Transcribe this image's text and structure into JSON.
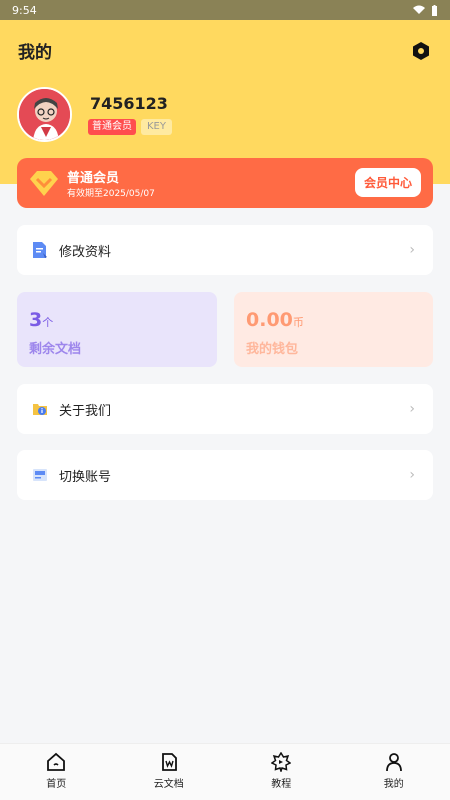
{
  "status_bar": {
    "time": "9:54"
  },
  "header": {
    "title": "我的"
  },
  "profile": {
    "username": "7456123",
    "member_badge": "普通会员",
    "key_badge": "KEY"
  },
  "vip": {
    "title": "普通会员",
    "expiry": "有效期至2025/05/07",
    "button": "会员中心"
  },
  "menu": {
    "edit_profile": "修改资料",
    "about_us": "关于我们",
    "switch_account": "切换账号"
  },
  "stats": {
    "docs_value": "3",
    "docs_unit": "个",
    "docs_label": "剩余文档",
    "wallet_value": "0.00",
    "wallet_unit": "币",
    "wallet_label": "我的钱包"
  },
  "tabs": [
    {
      "label": "首页",
      "icon": "home-icon"
    },
    {
      "label": "云文档",
      "icon": "document-icon"
    },
    {
      "label": "教程",
      "icon": "tutorial-icon"
    },
    {
      "label": "我的",
      "icon": "user-icon"
    }
  ],
  "colors": {
    "header": "#ffd95f",
    "vip_card": "#ff6b45",
    "docs_card": "#e9e4fb",
    "wallet_card": "#ffeae3"
  }
}
